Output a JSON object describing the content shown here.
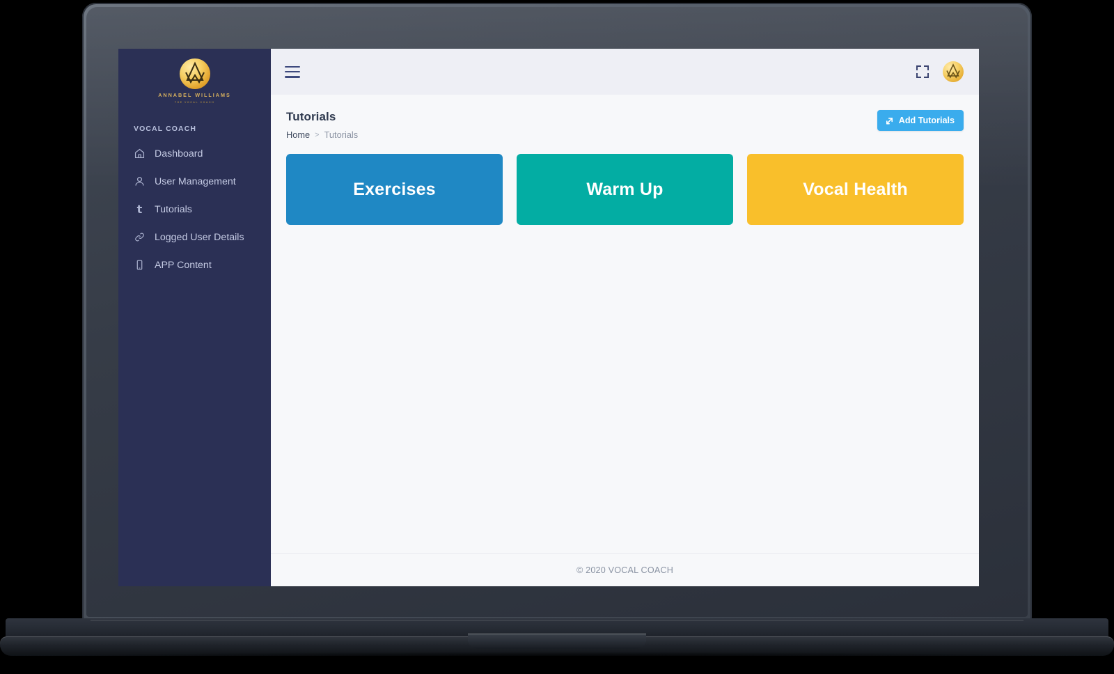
{
  "brand": {
    "name": "ANNABEL WILLIAMS",
    "tagline": "THE VOCAL COACH",
    "logo_icon": "aw-monogram-icon",
    "logo_color": "#e2a32c"
  },
  "sidebar": {
    "section_title": "VOCAL COACH",
    "bg_color": "#2b3055",
    "items": [
      {
        "label": "Dashboard",
        "icon": "home-icon"
      },
      {
        "label": "User Management",
        "icon": "user-icon"
      },
      {
        "label": "Tutorials",
        "icon": "letter-t-icon"
      },
      {
        "label": "Logged User Details",
        "icon": "link-icon"
      },
      {
        "label": "APP Content",
        "icon": "mobile-icon"
      }
    ]
  },
  "topbar": {
    "menu_icon": "hamburger-icon",
    "fullscreen_icon": "fullscreen-icon",
    "avatar_icon": "user-avatar-icon",
    "bg_color": "#eeeff5"
  },
  "page": {
    "title": "Tutorials",
    "breadcrumb": {
      "home": "Home",
      "separator": ">",
      "current": "Tutorials"
    },
    "add_button": {
      "label": "Add Tutorials",
      "icon": "arrow-share-icon",
      "color": "#3aaced"
    }
  },
  "cards": [
    {
      "label": "Exercises",
      "color": "#1f88c4"
    },
    {
      "label": "Warm Up",
      "color": "#03ada3"
    },
    {
      "label": "Vocal Health",
      "color": "#f9bf2b"
    }
  ],
  "footer": {
    "text": "© 2020 VOCAL COACH"
  }
}
